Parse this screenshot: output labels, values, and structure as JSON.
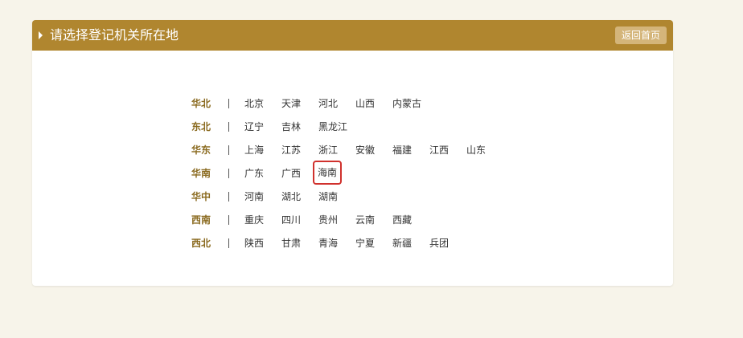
{
  "header": {
    "title": "请选择登记机关所在地",
    "back_label": "返回首页"
  },
  "colors": {
    "header_bg": "#b0862f",
    "back_button_bg": "#d4b57a",
    "region_label": "#8a6a1f",
    "selected_outline": "#d0312d"
  },
  "regions": [
    {
      "name": "华北",
      "provinces": [
        "北京",
        "天津",
        "河北",
        "山西",
        "内蒙古"
      ]
    },
    {
      "name": "东北",
      "provinces": [
        "辽宁",
        "吉林",
        "黑龙江"
      ]
    },
    {
      "name": "华东",
      "provinces": [
        "上海",
        "江苏",
        "浙江",
        "安徽",
        "福建",
        "江西",
        "山东"
      ]
    },
    {
      "name": "华南",
      "provinces": [
        "广东",
        "广西",
        "海南"
      ]
    },
    {
      "name": "华中",
      "provinces": [
        "河南",
        "湖北",
        "湖南"
      ]
    },
    {
      "name": "西南",
      "provinces": [
        "重庆",
        "四川",
        "贵州",
        "云南",
        "西藏"
      ]
    },
    {
      "name": "西北",
      "provinces": [
        "陕西",
        "甘肃",
        "青海",
        "宁夏",
        "新疆",
        "兵团"
      ]
    }
  ],
  "selected": "海南"
}
